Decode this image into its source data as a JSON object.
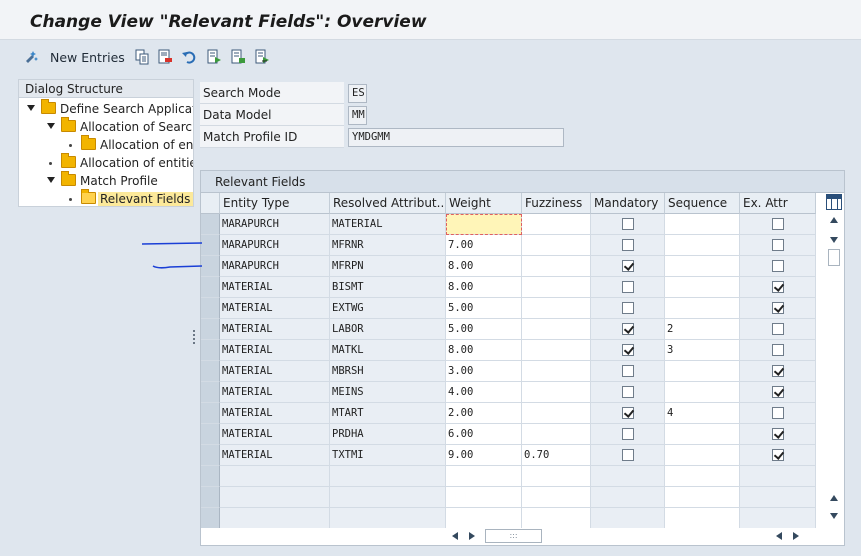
{
  "window": {
    "title": "Change View \"Relevant Fields\": Overview"
  },
  "toolbar": {
    "new_entries_label": "New Entries",
    "icons": [
      "new-entries-icon",
      "copy-icon",
      "delete-icon",
      "undo-icon",
      "select-all-icon",
      "deselect-icon",
      "select-block-icon"
    ]
  },
  "dialog_structure": {
    "header": "Dialog Structure",
    "items": [
      {
        "label": "Define Search Applicatio",
        "level": 0,
        "expanded": true
      },
      {
        "label": "Allocation of Search",
        "level": 1,
        "expanded": true
      },
      {
        "label": "Allocation of enti",
        "level": 2
      },
      {
        "label": "Allocation of entities",
        "level": 1
      },
      {
        "label": "Match Profile",
        "level": 1,
        "expanded": true
      },
      {
        "label": "Relevant Fields",
        "level": 2,
        "selected": true
      }
    ]
  },
  "header_fields": {
    "search_mode": {
      "label": "Search Mode",
      "value": "ES"
    },
    "data_model": {
      "label": "Data Model",
      "value": "MM"
    },
    "match_profile": {
      "label": "Match Profile ID",
      "value": "YMDGMM"
    }
  },
  "table": {
    "title": "Relevant Fields",
    "columns": [
      "Entity Type",
      "Resolved Attribut...",
      "Weight",
      "Fuzziness",
      "Mandatory",
      "Sequence",
      "Ex. Attr"
    ],
    "rows": [
      {
        "entity": "MARAPURCH",
        "attr": "MATERIAL",
        "weight": "",
        "fuzziness": "",
        "mandatory": false,
        "sequence": "",
        "ex_attr": false
      },
      {
        "entity": "MARAPURCH",
        "attr": "MFRNR",
        "weight": "7.00",
        "fuzziness": "",
        "mandatory": false,
        "sequence": "",
        "ex_attr": false
      },
      {
        "entity": "MARAPURCH",
        "attr": "MFRPN",
        "weight": "8.00",
        "fuzziness": "",
        "mandatory": true,
        "sequence": "",
        "ex_attr": false
      },
      {
        "entity": "MATERIAL",
        "attr": "BISMT",
        "weight": "8.00",
        "fuzziness": "",
        "mandatory": false,
        "sequence": "",
        "ex_attr": true
      },
      {
        "entity": "MATERIAL",
        "attr": "EXTWG",
        "weight": "5.00",
        "fuzziness": "",
        "mandatory": false,
        "sequence": "",
        "ex_attr": true
      },
      {
        "entity": "MATERIAL",
        "attr": "LABOR",
        "weight": "5.00",
        "fuzziness": "",
        "mandatory": true,
        "sequence": "2",
        "ex_attr": false
      },
      {
        "entity": "MATERIAL",
        "attr": "MATKL",
        "weight": "8.00",
        "fuzziness": "",
        "mandatory": true,
        "sequence": "3",
        "ex_attr": false
      },
      {
        "entity": "MATERIAL",
        "attr": "MBRSH",
        "weight": "3.00",
        "fuzziness": "",
        "mandatory": false,
        "sequence": "",
        "ex_attr": true
      },
      {
        "entity": "MATERIAL",
        "attr": "MEINS",
        "weight": "4.00",
        "fuzziness": "",
        "mandatory": false,
        "sequence": "",
        "ex_attr": true
      },
      {
        "entity": "MATERIAL",
        "attr": "MTART",
        "weight": "2.00",
        "fuzziness": "",
        "mandatory": true,
        "sequence": "4",
        "ex_attr": false
      },
      {
        "entity": "MATERIAL",
        "attr": "PRDHA",
        "weight": "6.00",
        "fuzziness": "",
        "mandatory": false,
        "sequence": "",
        "ex_attr": true
      },
      {
        "entity": "MATERIAL",
        "attr": "TXTMI",
        "weight": "9.00",
        "fuzziness": "0.70",
        "mandatory": false,
        "sequence": "",
        "ex_attr": true
      }
    ],
    "empty_rows": 3
  },
  "colors": {
    "background": "#dfe6ee",
    "pen_mark": "#1a3fd6",
    "focus_cell": "#fff5b8",
    "folder": "#f2b400"
  }
}
